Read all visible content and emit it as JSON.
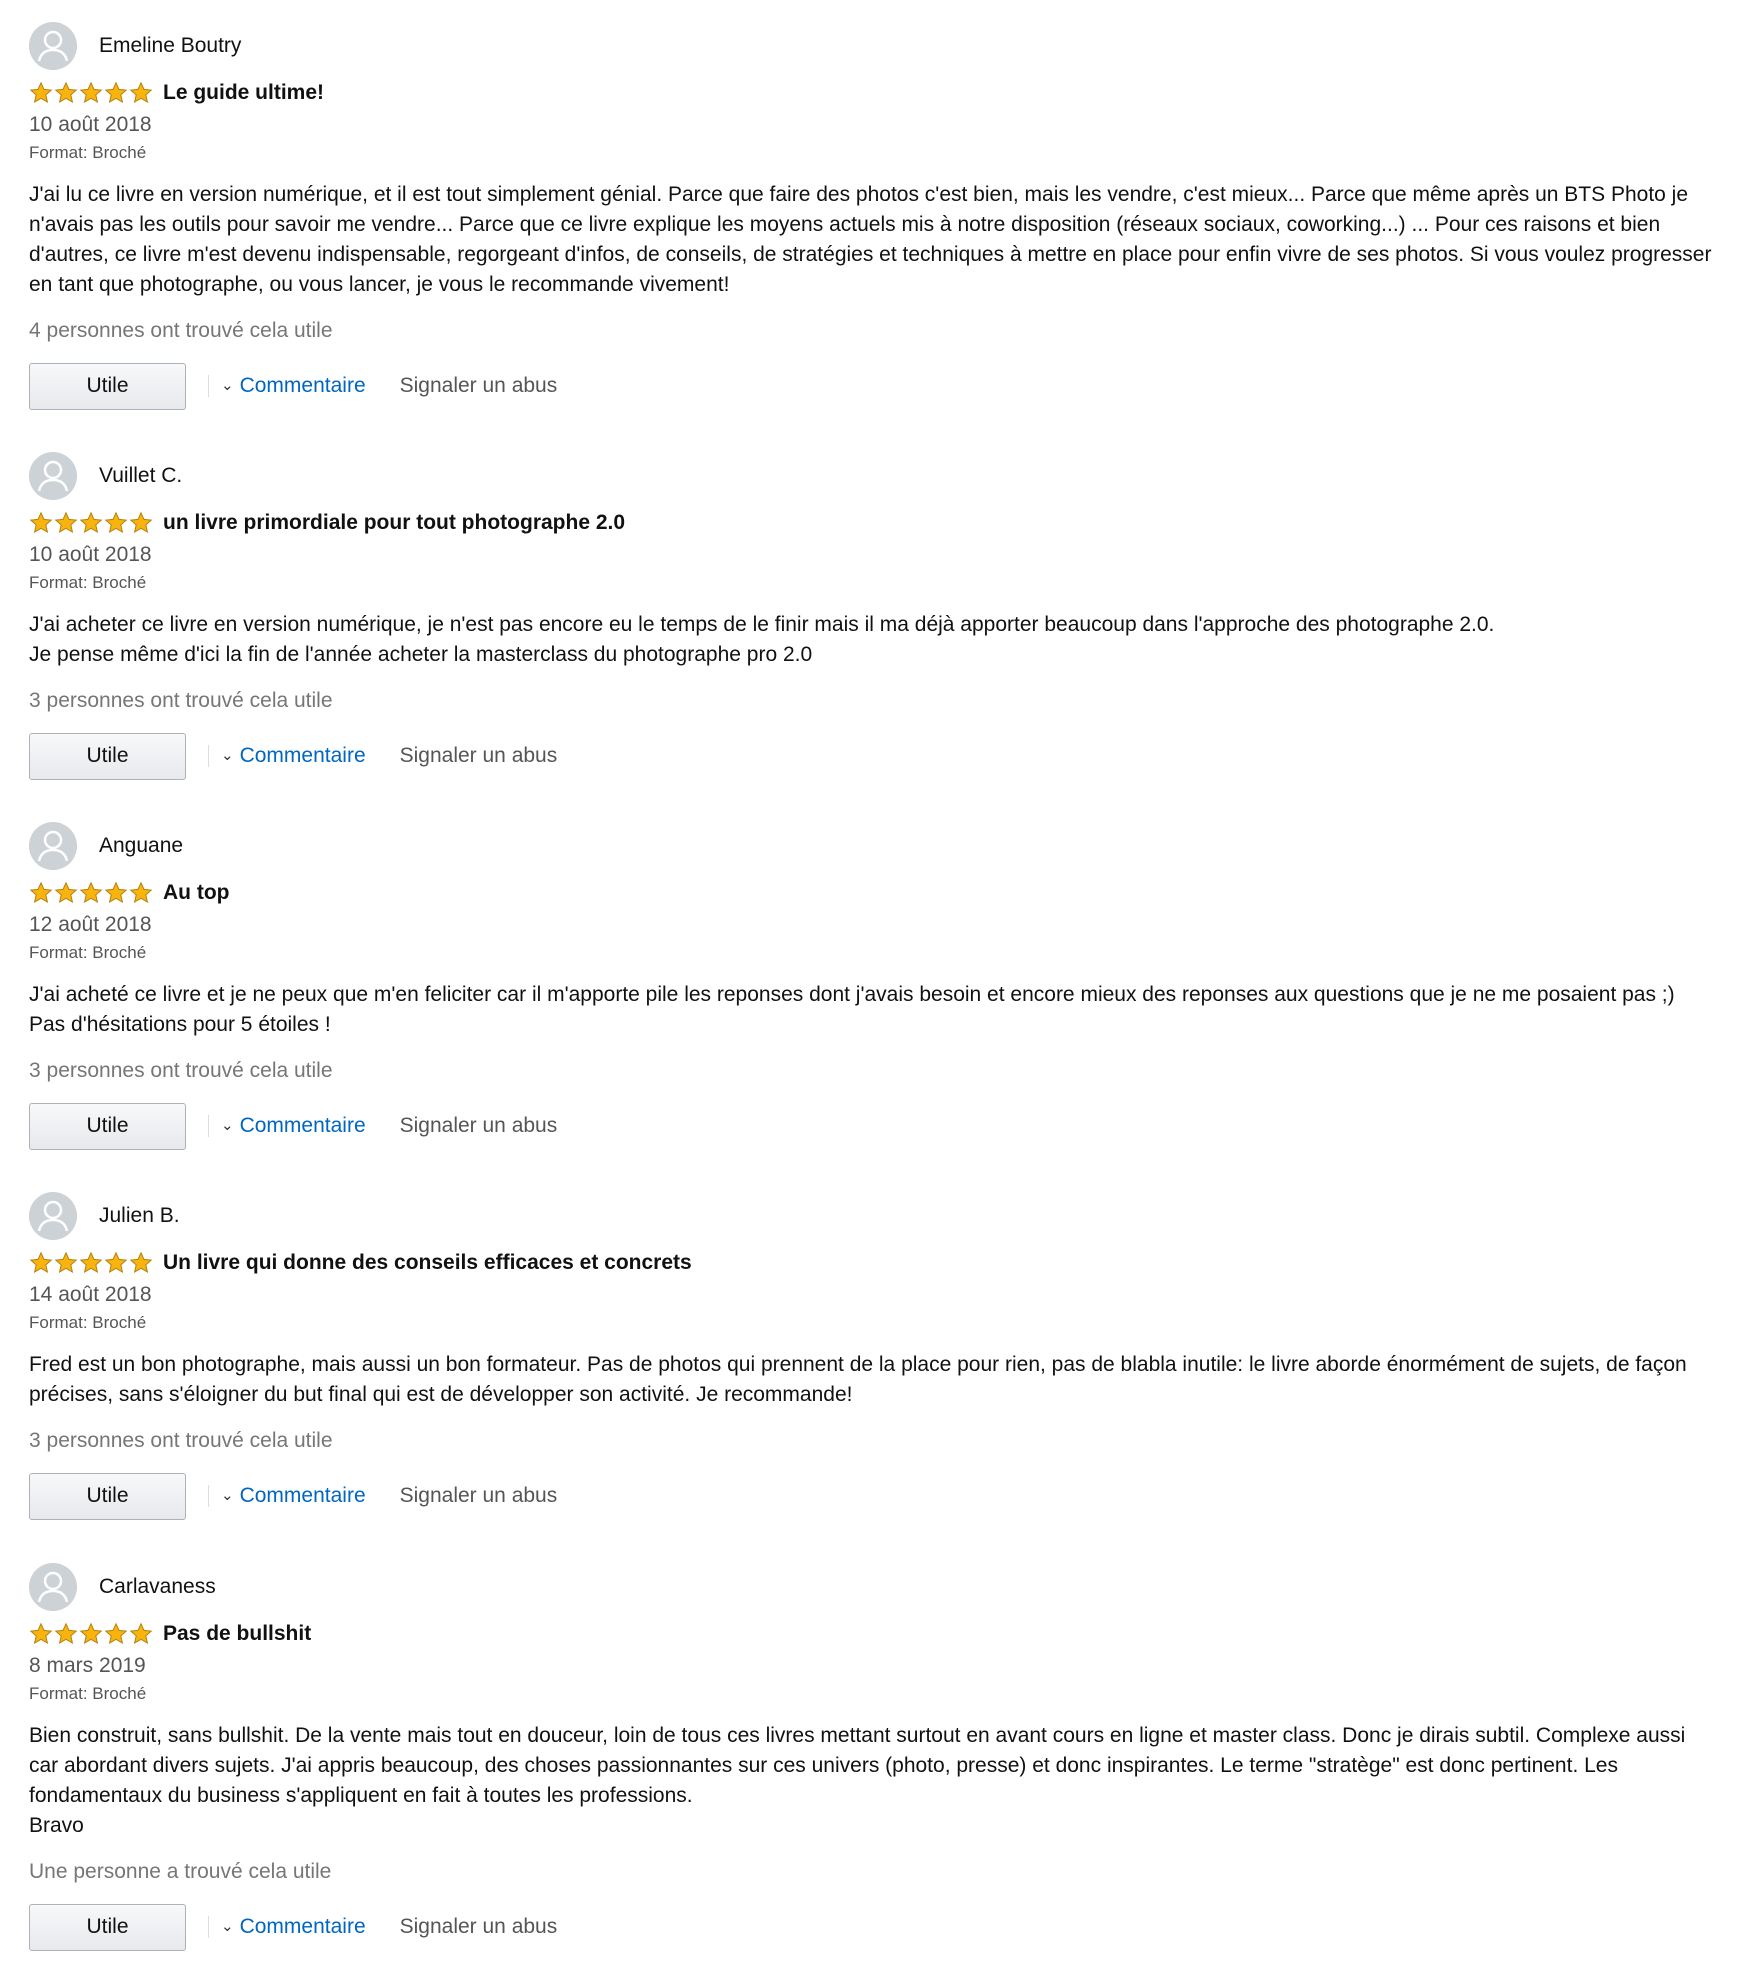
{
  "reviews": [
    {
      "reviewer": "Emeline Boutry",
      "rating": 5,
      "title": "Le guide ultime!",
      "date": "10 août 2018",
      "format": "Format: Broché",
      "body": "J'ai lu ce livre en version numérique, et il est tout simplement génial. Parce que faire des photos c'est bien, mais les vendre, c'est mieux... Parce que même après un BTS Photo je n'avais pas les outils pour savoir me vendre... Parce que ce livre explique les moyens actuels mis à notre disposition (réseaux sociaux, coworking...) ... Pour ces raisons et bien d'autres, ce livre m'est devenu indispensable, regorgeant d'infos, de conseils, de stratégies et techniques à mettre en place pour enfin vivre de ses photos. Si vous voulez progresser en tant que photographe, ou vous lancer, je vous le recommande vivement!",
      "helpful": "4 personnes ont trouvé cela utile"
    },
    {
      "reviewer": "Vuillet C.",
      "rating": 5,
      "title": "un livre primordiale pour tout photographe 2.0",
      "date": "10 août 2018",
      "format": "Format: Broché",
      "body": "J'ai acheter ce livre en version numérique, je n'est pas encore eu le temps de le finir mais il ma déjà apporter beaucoup dans l'approche des photographe 2.0.\nJe pense même d'ici la fin de l'année acheter la masterclass du photographe pro 2.0",
      "helpful": "3 personnes ont trouvé cela utile"
    },
    {
      "reviewer": "Anguane",
      "rating": 5,
      "title": "Au top",
      "date": "12 août 2018",
      "format": "Format: Broché",
      "body": "J'ai acheté ce livre et je ne peux que m'en feliciter car il m'apporte pile les reponses dont j'avais besoin et encore mieux des reponses aux questions que je ne me posaient pas ;)\nPas d'hésitations pour 5 étoiles !",
      "helpful": "3 personnes ont trouvé cela utile"
    },
    {
      "reviewer": "Julien B.",
      "rating": 5,
      "title": "Un livre qui donne des conseils efficaces et concrets",
      "date": "14 août 2018",
      "format": "Format: Broché",
      "body": "Fred est un bon photographe, mais aussi un bon formateur. Pas de photos qui prennent de la place pour rien, pas de blabla inutile: le livre aborde énormément de sujets, de façon précises, sans s'éloigner du but final qui est de développer son activité. Je recommande!",
      "helpful": "3 personnes ont trouvé cela utile"
    },
    {
      "reviewer": "Carlavaness",
      "rating": 5,
      "title": "Pas de bullshit",
      "date": "8 mars 2019",
      "format": "Format: Broché",
      "body": "Bien construit, sans bullshit. De la vente mais tout en douceur, loin de tous ces livres mettant surtout en avant cours en ligne et master class. Donc je dirais subtil. Complexe aussi car abordant divers sujets. J'ai appris beaucoup, des choses passionnantes sur ces univers (photo, presse) et donc inspirantes. Le terme \"stratège\" est donc pertinent. Les fondamentaux du business s'appliquent en fait à toutes les professions.\nBravo",
      "helpful": "Une personne a trouvé cela utile"
    }
  ],
  "actions": {
    "useful_label": "Utile",
    "comment_label": "Commentaire",
    "report_label": "Signaler un abus"
  },
  "colors": {
    "star": "#f8b30f",
    "link": "#0066c0",
    "muted": "#767676"
  },
  "icons": {
    "avatar": "user-avatar-icon",
    "star": "star-icon",
    "chevron": "chevron-down-icon"
  }
}
